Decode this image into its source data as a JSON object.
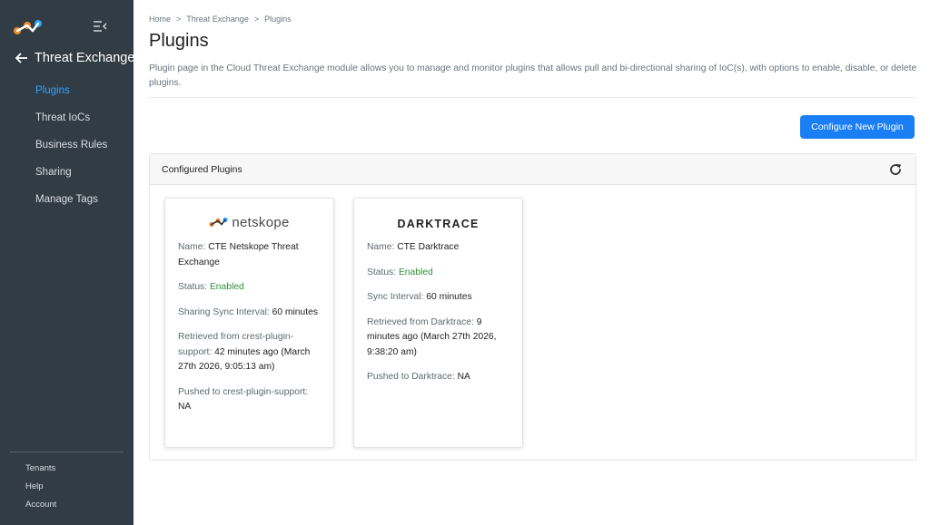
{
  "sidebar": {
    "back_title": "Threat Exchange",
    "items": [
      {
        "label": "Plugins"
      },
      {
        "label": "Threat IoCs"
      },
      {
        "label": "Business Rules"
      },
      {
        "label": "Sharing"
      },
      {
        "label": "Manage Tags"
      }
    ],
    "bottom_links": [
      {
        "label": "Tenants"
      },
      {
        "label": "Help"
      },
      {
        "label": "Account"
      }
    ],
    "active_color": "#2ba4ff"
  },
  "breadcrumb": [
    "Home",
    "Threat Exchange",
    "Plugins"
  ],
  "breadcrumb_sep": ">",
  "page": {
    "title": "Plugins",
    "description": "Plugin page in the Cloud Threat Exchange module allows you to manage and monitor plugins that allows pull and bi-directional sharing of IoC(s), with options to enable, disable, or delete plugins.",
    "configure_button": "Configure New Plugin"
  },
  "panel": {
    "title": "Configured Plugins",
    "refresh_icon": "refresh-icon"
  },
  "plugins": [
    {
      "logo_text": "netskope",
      "name_label": "Name:",
      "name": "CTE Netskope Threat Exchange",
      "status_label": "Status:",
      "status": "Enabled",
      "sync_label": "Sharing Sync Interval:",
      "sync": "60 minutes",
      "retrieved_label": "Retrieved from crest-plugin-support:",
      "retrieved": "42 minutes ago (March 27th 2026, 9:05:13 am)",
      "pushed_label": "Pushed to crest-plugin-support:",
      "pushed": "NA"
    },
    {
      "logo_text": "DARKTRACE",
      "name_label": "Name:",
      "name": "CTE Darktrace",
      "status_label": "Status:",
      "status": "Enabled",
      "sync_label": "Sync Interval:",
      "sync": "60 minutes",
      "retrieved_label": "Retrieved from Darktrace:",
      "retrieved": "9 minutes ago (March 27th 2026, 9:38:20 am)",
      "pushed_label": "Pushed to Darktrace:",
      "pushed": "NA"
    }
  ],
  "colors": {
    "sidebar_bg": "#323c45",
    "primary": "#1a7ef5",
    "enabled": "#2d8f34"
  }
}
